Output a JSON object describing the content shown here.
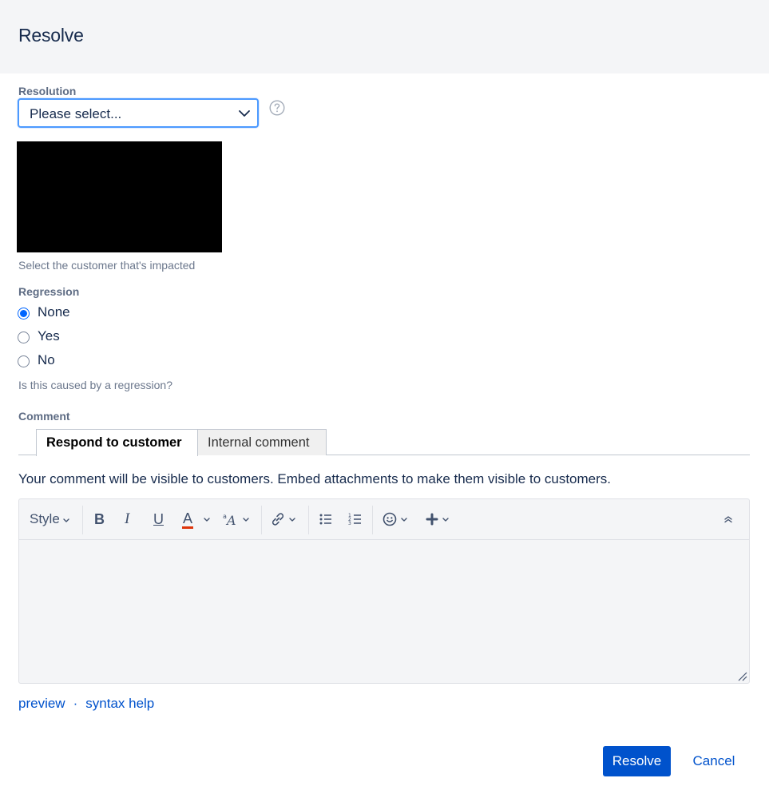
{
  "dialog": {
    "title": "Resolve"
  },
  "resolution": {
    "label": "Resolution",
    "selected": "Please select...",
    "help_icon": "question-circle-icon"
  },
  "customer": {
    "description": "Select the customer that's impacted"
  },
  "regression": {
    "label": "Regression",
    "options": [
      {
        "label": "None",
        "checked": true
      },
      {
        "label": "Yes",
        "checked": false
      },
      {
        "label": "No",
        "checked": false
      }
    ],
    "description": "Is this caused by a regression?"
  },
  "comment": {
    "label": "Comment",
    "tabs": [
      {
        "label": "Respond to customer",
        "active": true
      },
      {
        "label": "Internal comment",
        "active": false
      }
    ],
    "note": "Your comment will be visible to customers. Embed attachments to make them visible to customers.",
    "toolbar": {
      "style_label": "Style",
      "bold": "B",
      "italic": "I",
      "underline": "U",
      "text_color": "A",
      "text_color_underline": "#de350b",
      "icons": [
        "chevron-down-icon",
        "text-size-icon",
        "link-icon",
        "bullet-list-icon",
        "numbered-list-icon",
        "emoji-icon",
        "plus-icon",
        "collapse-icon"
      ]
    },
    "preview_link": "preview",
    "separator": "·",
    "syntax_link": "syntax help"
  },
  "footer": {
    "resolve_label": "Resolve",
    "cancel_label": "Cancel",
    "primary_color": "#0052cc"
  }
}
